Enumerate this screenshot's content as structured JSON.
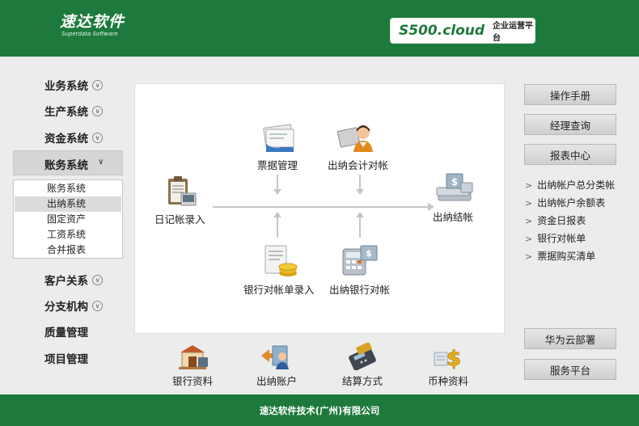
{
  "header": {
    "logo_main": "速达软件",
    "logo_sub": "Superdata Software",
    "product_name": "S500.cloud",
    "product_tag": "企业运营平台"
  },
  "nav": {
    "items_top": [
      {
        "label": "业务系统"
      },
      {
        "label": "生产系统"
      },
      {
        "label": "资金系统"
      }
    ],
    "active": {
      "label": "账务系统"
    },
    "submenu": [
      {
        "label": "账务系统"
      },
      {
        "label": "出纳系统",
        "selected": true
      },
      {
        "label": "固定资产"
      },
      {
        "label": "工资系统"
      },
      {
        "label": "合并报表"
      }
    ],
    "items_bottom": [
      {
        "label": "客户关系"
      },
      {
        "label": "分支机构"
      },
      {
        "label": "质量管理"
      },
      {
        "label": "项目管理"
      }
    ]
  },
  "flow": {
    "journal_entry": "日记帐录入",
    "bill_management": "票据管理",
    "cashier_accounting_reconcile": "出纳会计对帐",
    "cashier_closing": "出纳结帐",
    "bank_statement_entry": "银行对帐单录入",
    "cashier_bank_reconcile": "出纳银行对帐"
  },
  "bottom": {
    "bank_info": "银行资料",
    "cashier_account": "出纳账户",
    "settlement_method": "结算方式",
    "currency_info": "币种资料"
  },
  "right": {
    "buttons_top": [
      "操作手册",
      "经理查询",
      "报表中心"
    ],
    "links": [
      "出纳帐户总分类帐",
      "出纳帐户余额表",
      "资金日报表",
      "银行对帐单",
      "票据购买清单"
    ],
    "buttons_bottom": [
      "华为云部署",
      "服务平台"
    ]
  },
  "footer": {
    "text": "速达软件技术(广州)有限公司"
  },
  "colors": {
    "brand_green": "#1e7a3c",
    "background": "#ececec"
  }
}
